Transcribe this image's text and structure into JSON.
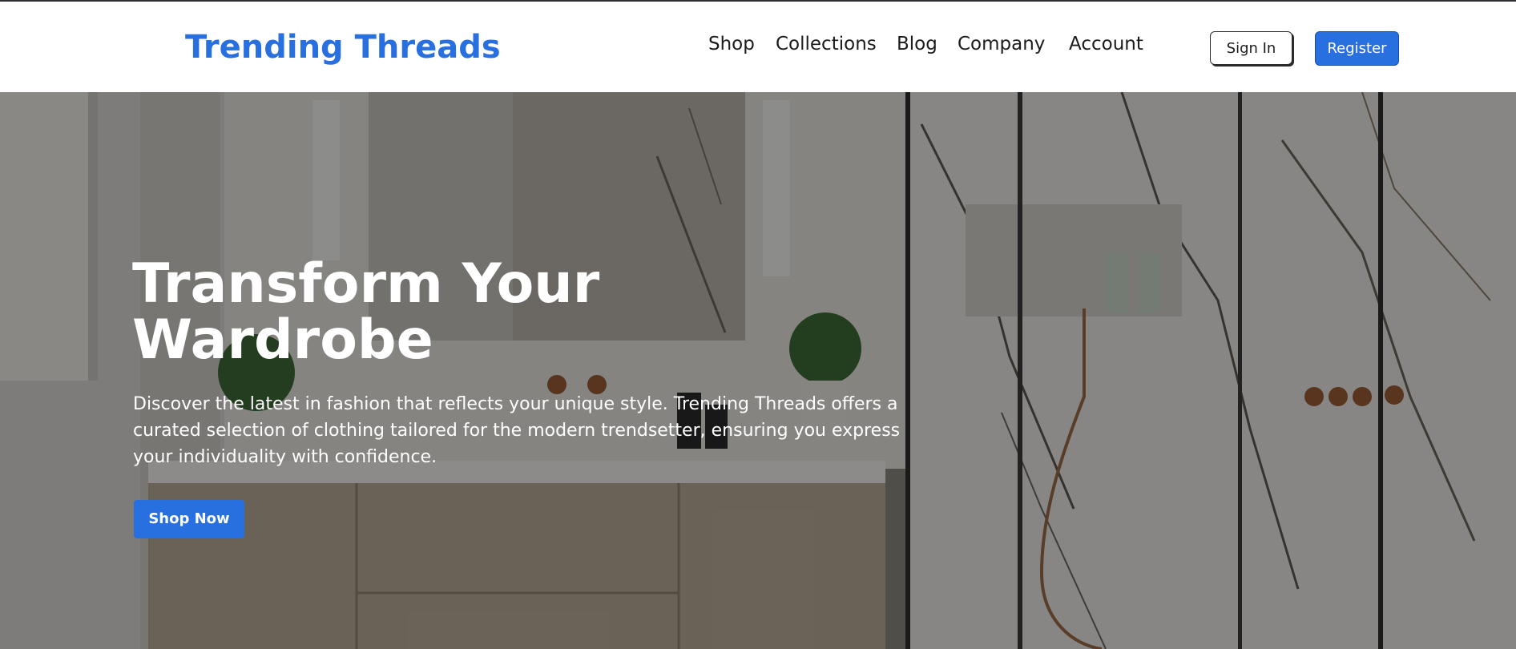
{
  "brand": {
    "name": "Trending Threads",
    "color": "#2870e0"
  },
  "nav": {
    "items": [
      {
        "label": "Shop"
      },
      {
        "label": "Collections"
      },
      {
        "label": "Blog"
      },
      {
        "label": "Company"
      },
      {
        "label": "Account"
      }
    ]
  },
  "auth": {
    "sign_in_label": "Sign In",
    "register_label": "Register"
  },
  "hero": {
    "title_line1": "Transform Your",
    "title_line2": "Wardrobe",
    "description": "Discover the latest in fashion that reflects your unique style. Trending Threads offers a curated selection of clothing tailored for the modern trendsetter, ensuring you express your individuality with confidence.",
    "cta_label": "Shop Now",
    "background": "marble-bathroom-photo"
  }
}
